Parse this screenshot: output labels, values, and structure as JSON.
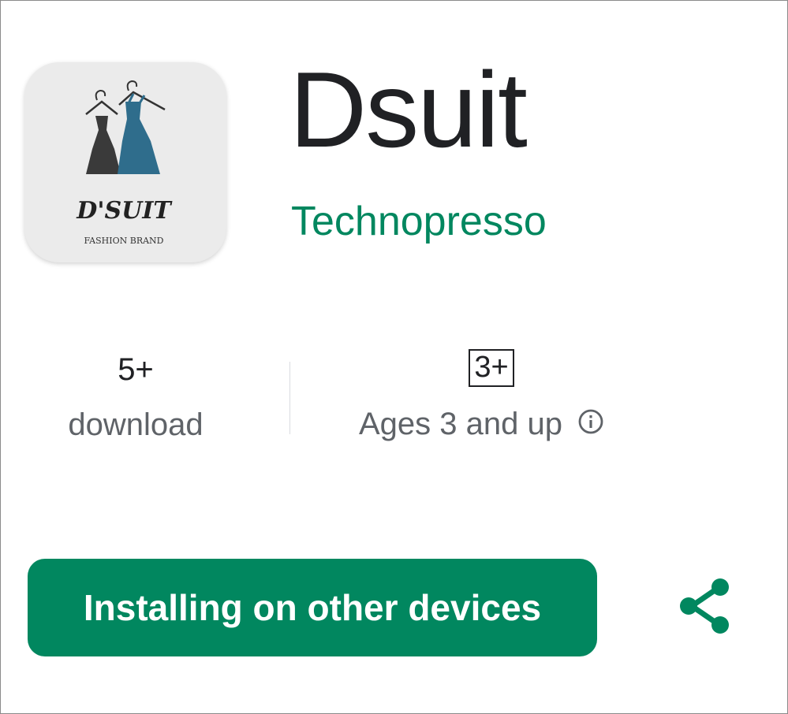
{
  "app": {
    "title": "Dsuit",
    "developer": "Technopresso",
    "icon_logo_text": "D'SUIT",
    "icon_tagline": "FASHION BRAND"
  },
  "stats": {
    "downloads_value": "5+",
    "downloads_label": "download",
    "rating_value": "3+",
    "rating_label": "Ages 3 and up"
  },
  "actions": {
    "install_label": "Installing on other devices",
    "share_icon": "share-icon",
    "info_icon": "info-icon"
  },
  "colors": {
    "accent": "#01875f",
    "text_primary": "#202124",
    "text_secondary": "#5f6368"
  }
}
